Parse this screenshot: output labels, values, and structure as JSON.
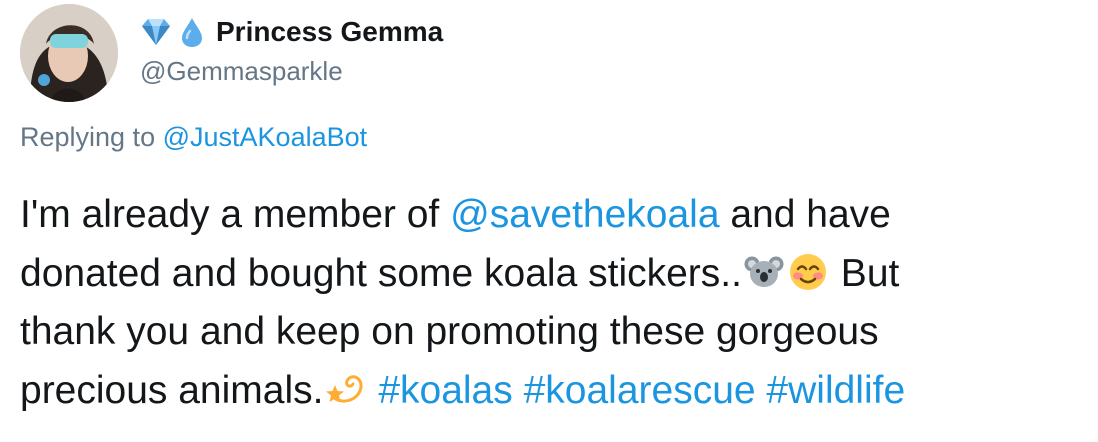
{
  "tweet": {
    "author": {
      "display_name": "Princess Gemma",
      "handle": "@Gemmasparkle",
      "name_badges": [
        "gem-stone-emoji",
        "droplet-emoji"
      ]
    },
    "reply_prefix": "Replying to",
    "reply_to": "@JustAKoalaBot",
    "text": {
      "line1_a": "I'm already a member of ",
      "line1_mention": "@savethekoala",
      "line1_b": " and have",
      "line2_a": "donated and bought some koala stickers..",
      "line2_b": " But",
      "line3": "thank you and keep on promoting these gorgeous",
      "line4_a": "precious animals.",
      "hashtags": [
        "#koalas",
        "#koalarescue",
        "#wildlife"
      ]
    },
    "emojis": [
      "koala-emoji",
      "smiling-face-emoji",
      "dizzy-star-emoji"
    ],
    "colors": {
      "link": "#1b95e0",
      "secondary": "#657786",
      "text": "#14171a"
    }
  }
}
